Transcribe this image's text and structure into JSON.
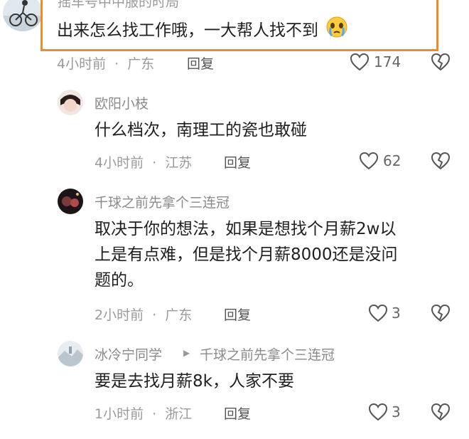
{
  "comments": [
    {
      "name": "摇车号中中服的时局",
      "text": "出来怎么找工作哦，一大帮人找不到",
      "emoji_icon": "crying-face-icon",
      "time": "4小时前",
      "location": "广东",
      "reply_label": "回复",
      "likes": "174"
    },
    {
      "name": "欧阳小枝",
      "text": "什么档次，南理工的瓷也敢碰",
      "time": "4小时前",
      "location": "江苏",
      "reply_label": "回复",
      "likes": "62"
    },
    {
      "name": "千球之前先拿个三连冠",
      "text_lines": [
        "取决于你的想法，如果是想找个月薪2w以",
        "上是有点难，但是找个月薪8000还是没问",
        "题的。"
      ],
      "time": "2小时前",
      "location": "广东",
      "reply_label": "回复",
      "likes": "3"
    },
    {
      "name": "冰冷宁同学",
      "reply_to": "千球之前先拿个三连冠",
      "text": "要是去找月薪8k，人家不要",
      "time": "1小时前",
      "location": "浙江",
      "reply_label": "回复",
      "likes": "3"
    }
  ],
  "separator": "·",
  "colors": {
    "highlight": "#f08a2a",
    "name": "#8a8a8a",
    "meta": "#9a9a9a"
  }
}
